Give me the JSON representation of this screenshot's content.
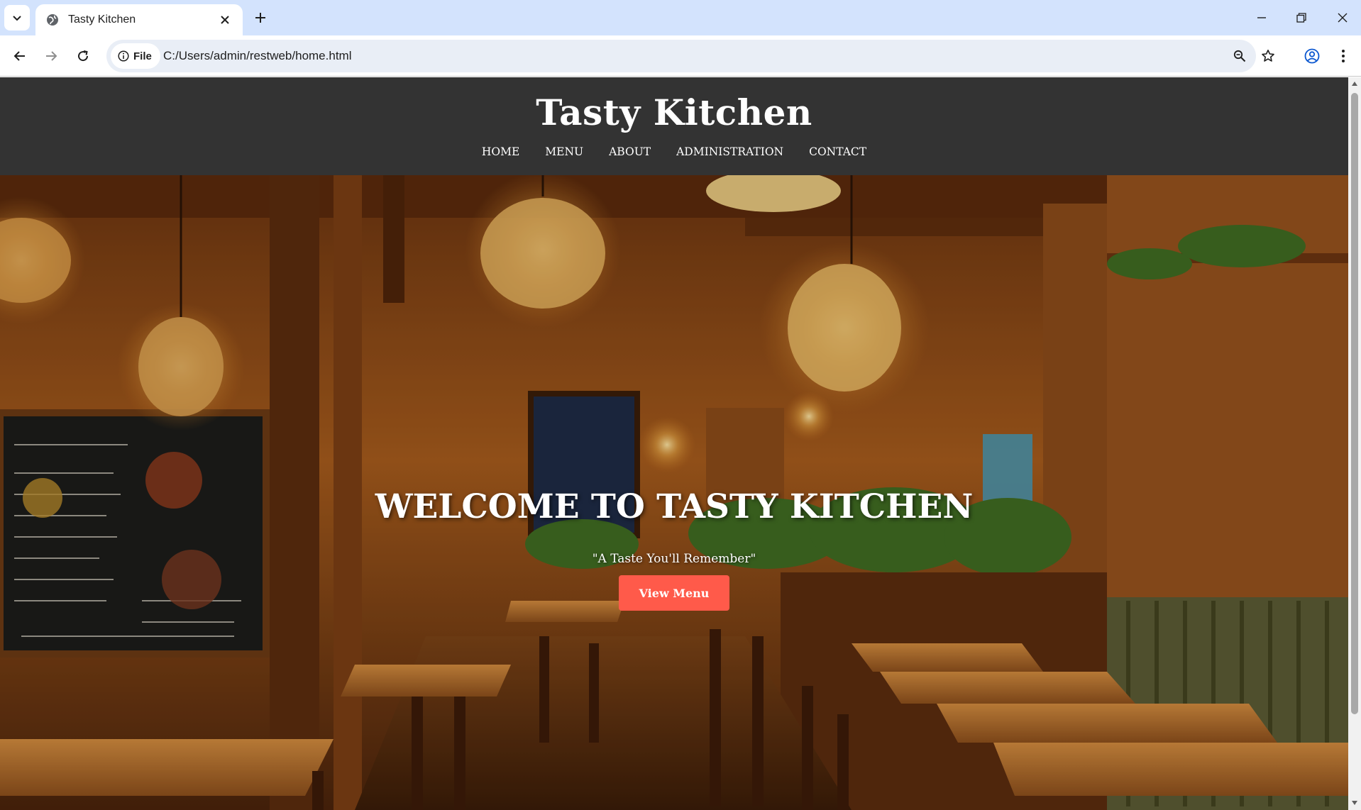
{
  "browser": {
    "tab_title": "Tasty Kitchen",
    "chip_label": "File",
    "url": "C:/Users/admin/restweb/home.html",
    "icons": [
      "tab-search-icon",
      "globe-icon",
      "close-icon",
      "plus-icon",
      "minimize-icon",
      "restore-icon",
      "window-close-icon",
      "back-arrow-icon",
      "forward-arrow-icon",
      "reload-icon",
      "info-icon",
      "zoom-icon",
      "star-icon",
      "profile-icon",
      "kebab-menu-icon"
    ]
  },
  "site": {
    "title": "Tasty Kitchen",
    "nav": [
      {
        "label": "HOME"
      },
      {
        "label": "MENU"
      },
      {
        "label": "ABOUT"
      },
      {
        "label": "ADMINISTRATION"
      },
      {
        "label": "CONTACT"
      }
    ]
  },
  "hero": {
    "headline": "WELCOME TO TASTY KITCHEN",
    "tagline": "\"A Taste You'll Remember\"",
    "cta_label": "View Menu",
    "image_semantic": "restaurant-interior-photo"
  },
  "colors": {
    "header_bg": "#333333",
    "cta_bg": "#ff5a4a",
    "tabbar_bg": "#d3e3fd",
    "omnibox_bg": "#e9eef6"
  }
}
